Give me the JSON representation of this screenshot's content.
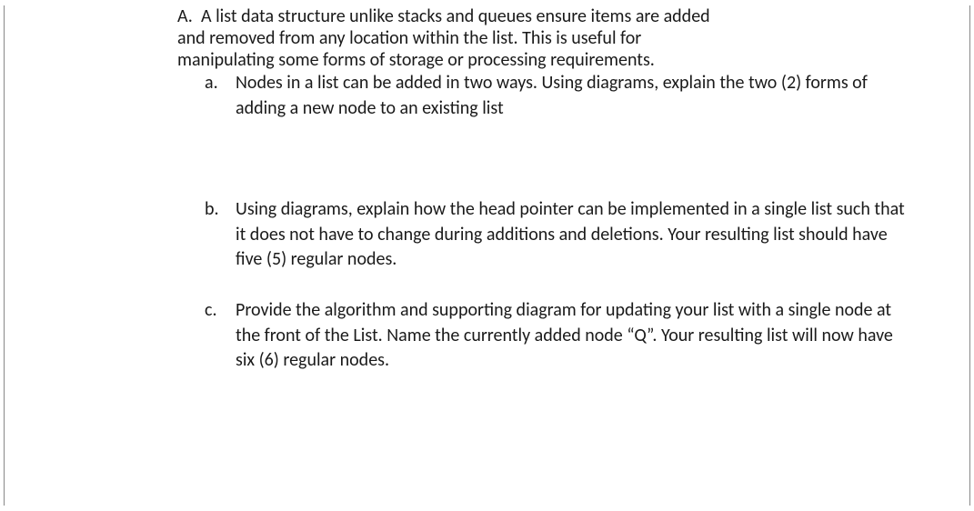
{
  "question": {
    "marker": "A.",
    "intro_line1": "A list data structure unlike stacks and queues ensure items are added",
    "intro_line2": "and removed from any location within the list. This is useful for",
    "intro_line3": "manipulating some forms of storage or processing requirements.",
    "subitems": [
      {
        "marker": "a.",
        "text": "Nodes in a list can be added in two ways. Using diagrams, explain the two (2) forms of adding a new node to an existing list"
      },
      {
        "marker": "b.",
        "text": "Using diagrams, explain how the head pointer can be implemented in a single list such that it does not have to change during additions and deletions. Your resulting list should have five (5) regular nodes."
      },
      {
        "marker": "c.",
        "text": "Provide the algorithm and supporting diagram for updating your list with a single node at the front of the List. Name the currently added node “Q”. Your resulting list will now have six (6) regular nodes."
      }
    ]
  }
}
